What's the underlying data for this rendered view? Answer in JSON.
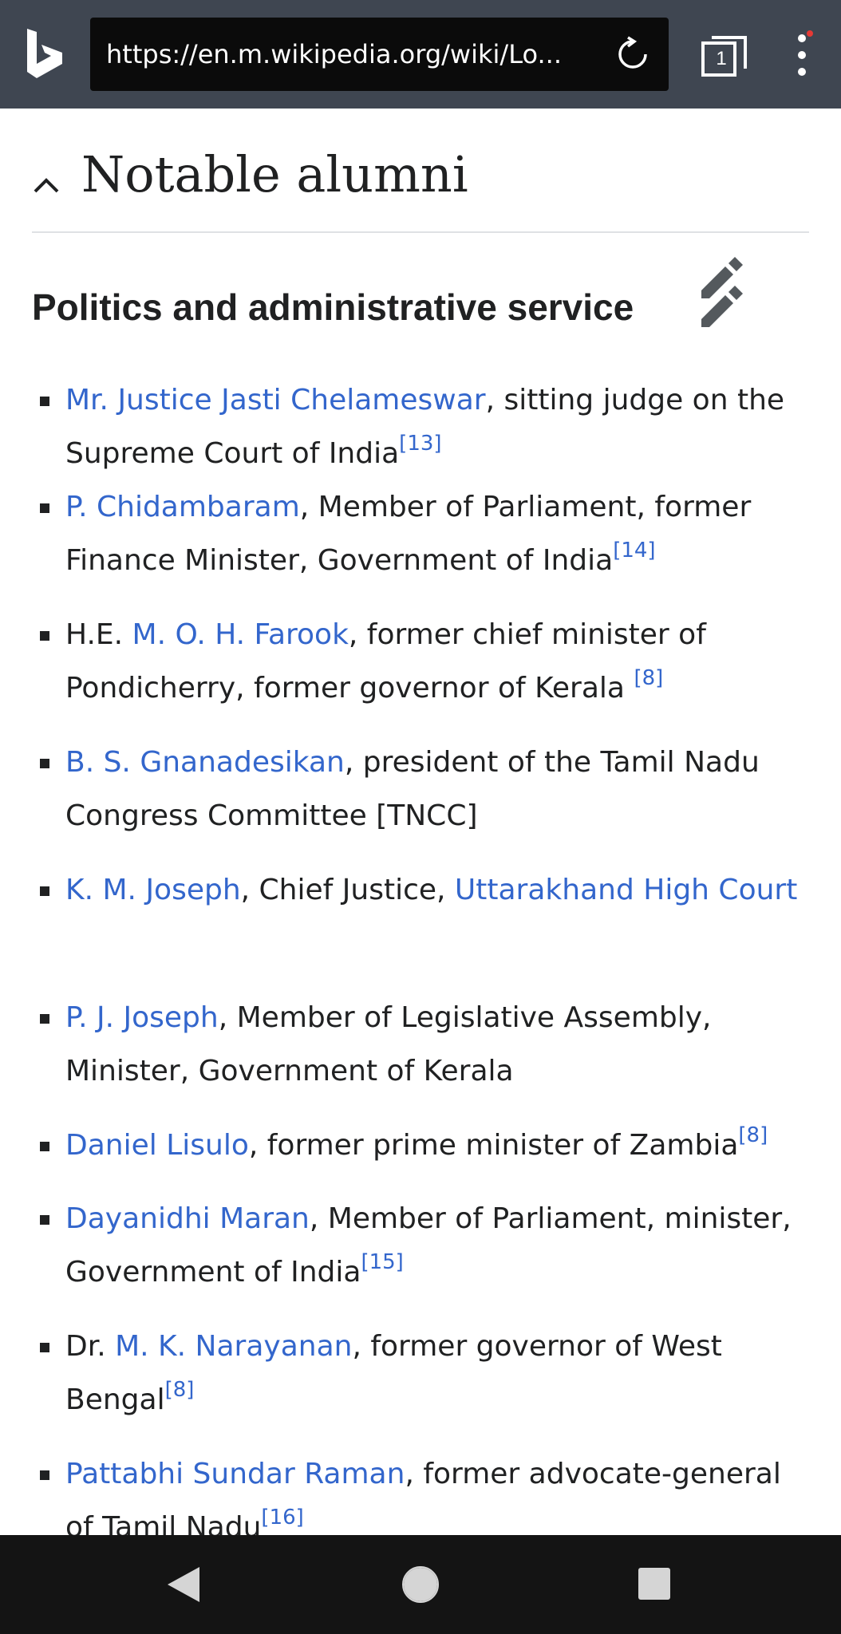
{
  "browser": {
    "url": "https://en.m.wikipedia.org/wiki/Lo...",
    "tab_count": "1",
    "logo_icon": "bing-logo-icon",
    "menu_has_notification": true
  },
  "section": {
    "title": "Notable alumni",
    "subsection_title": "Politics and administrative service"
  },
  "alumni": [
    {
      "parts": [
        {
          "text": "Mr. Justice Jasti Chelameswar",
          "type": "link"
        },
        {
          "text": ", sitting judge on the Supreme Court of India",
          "type": "text"
        },
        {
          "text": "[13]",
          "type": "ref"
        }
      ]
    },
    {
      "parts": [
        {
          "text": "P. Chidambaram",
          "type": "link"
        },
        {
          "text": ", Member of Parliament, former Finance Minister, Government of India",
          "type": "text"
        },
        {
          "text": "[14]",
          "type": "ref"
        }
      ]
    },
    {
      "parts": [
        {
          "text": "H.E. ",
          "type": "text"
        },
        {
          "text": "M. O. H. Farook",
          "type": "link"
        },
        {
          "text": ", former chief minister of Pondicherry, former governor of Kerala ",
          "type": "text"
        },
        {
          "text": "[8]",
          "type": "ref"
        }
      ]
    },
    {
      "parts": [
        {
          "text": "B. S. Gnanadesikan",
          "type": "link"
        },
        {
          "text": ", president of the Tamil Nadu Congress Committee [TNCC]",
          "type": "text"
        }
      ]
    },
    {
      "parts": [
        {
          "text": "K. M. Joseph",
          "type": "link"
        },
        {
          "text": ", Chief Justice, ",
          "type": "text"
        },
        {
          "text": "Uttarakhand High Court",
          "type": "link"
        }
      ]
    },
    {
      "parts": [
        {
          "text": "P. J. Joseph",
          "type": "link"
        },
        {
          "text": ", Member of Legislative Assembly, Minister, Government of Kerala",
          "type": "text"
        }
      ]
    },
    {
      "parts": [
        {
          "text": "Daniel Lisulo",
          "type": "link"
        },
        {
          "text": ", former prime minister of Zambia",
          "type": "text"
        },
        {
          "text": "[8]",
          "type": "ref"
        }
      ]
    },
    {
      "parts": [
        {
          "text": "Dayanidhi Maran",
          "type": "link"
        },
        {
          "text": ", Member of Parliament, minister, Government of India",
          "type": "text"
        },
        {
          "text": "[15]",
          "type": "ref"
        }
      ]
    },
    {
      "parts": [
        {
          "text": "Dr. ",
          "type": "text"
        },
        {
          "text": "M. K. Narayanan",
          "type": "link"
        },
        {
          "text": ", former governor of West Bengal",
          "type": "text"
        },
        {
          "text": "[8]",
          "type": "ref"
        }
      ]
    },
    {
      "parts": [
        {
          "text": "Pattabhi Sundar Raman",
          "type": "link"
        },
        {
          "text": ", former advocate-general of Tamil Nadu",
          "type": "text"
        },
        {
          "text": "[16]",
          "type": "ref"
        }
      ]
    }
  ],
  "colors": {
    "link": "#3366cc",
    "toolbar": "#3f4651",
    "text": "#202122",
    "navbar": "#141414"
  },
  "navbar": {
    "back_icon": "back-triangle-icon",
    "home_icon": "home-circle-icon",
    "recents_icon": "recents-square-icon"
  }
}
